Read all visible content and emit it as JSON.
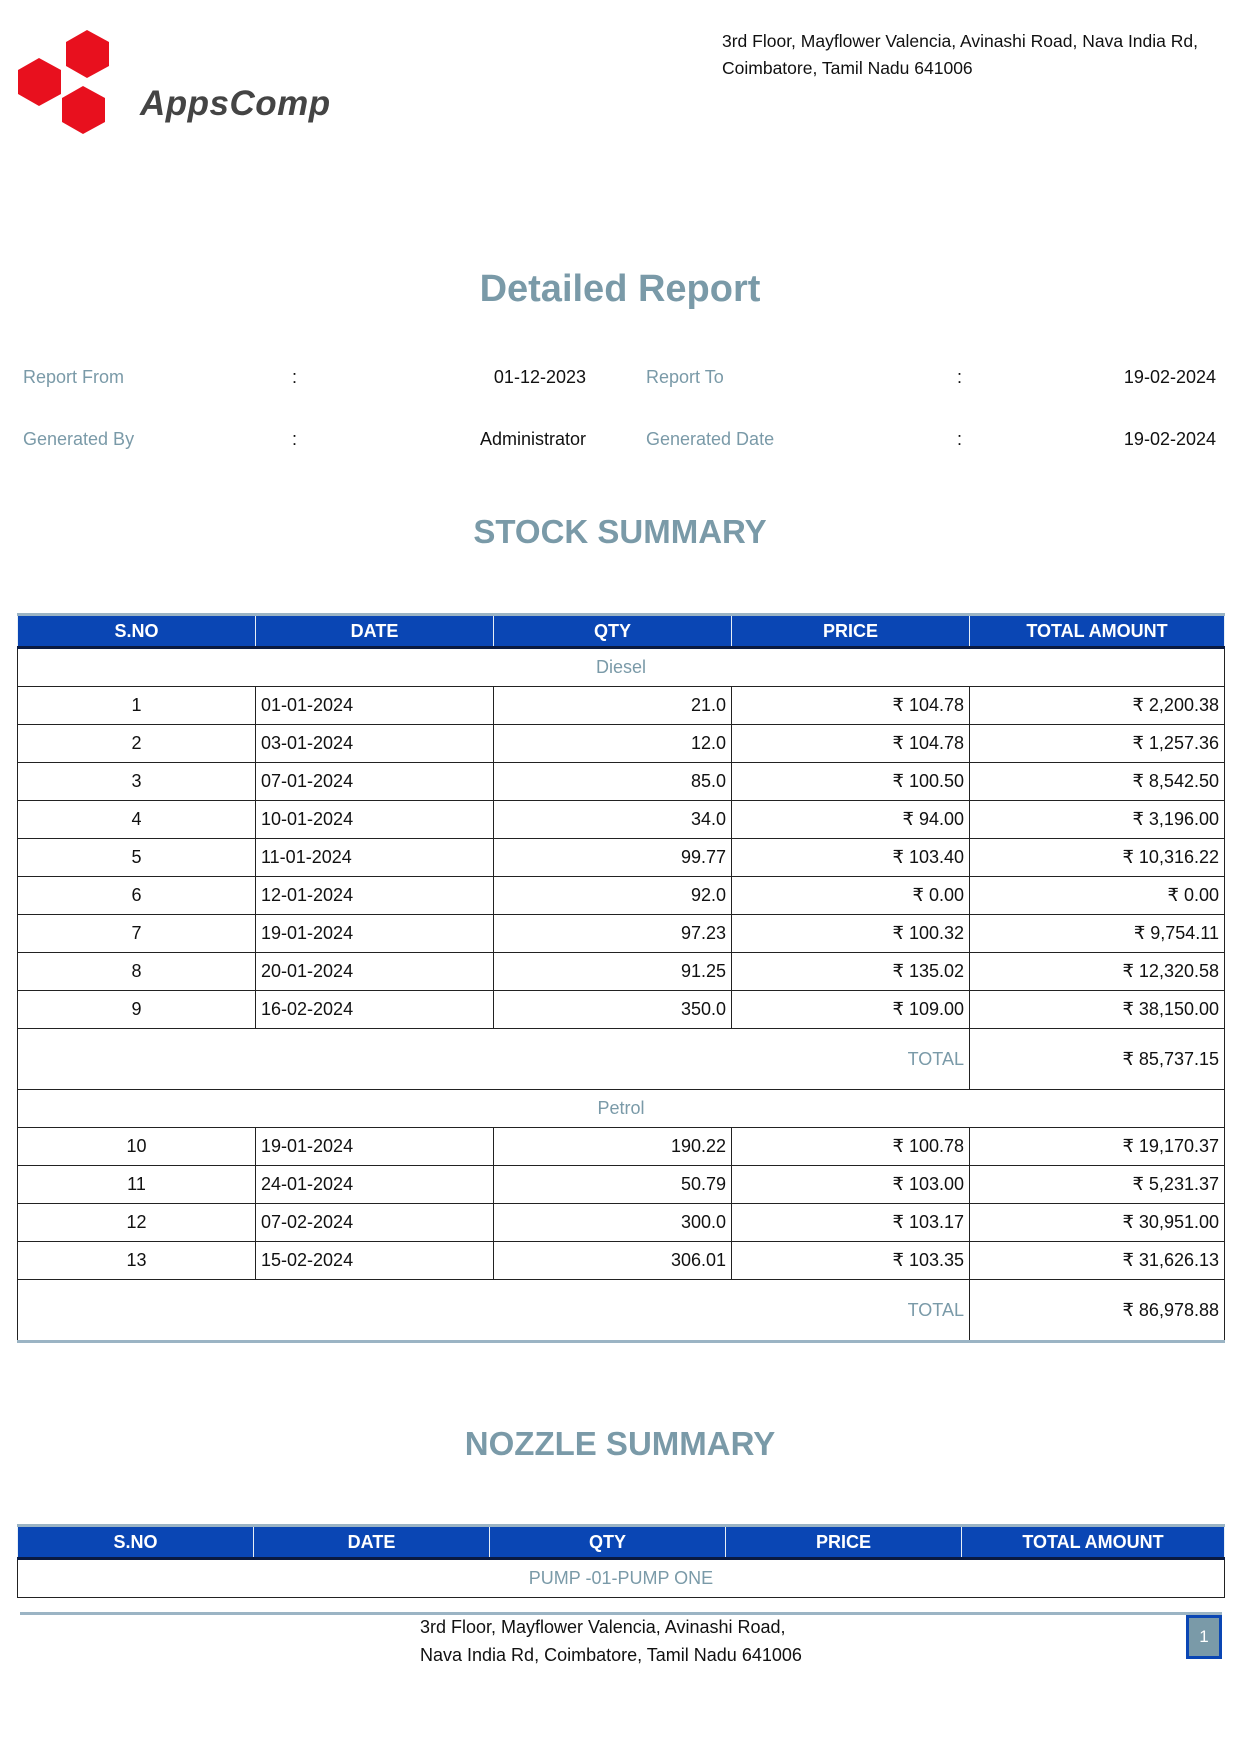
{
  "company": {
    "logo_name": "AppsComp",
    "address_line1": "3rd Floor, Mayflower Valencia, Avinashi Road, Nava India Rd,",
    "address_line2": "Coimbatore, Tamil Nadu 641006"
  },
  "report": {
    "title": "Detailed Report",
    "meta": {
      "from_label": "Report From",
      "from_value": "01-12-2023",
      "to_label": "Report To",
      "to_value": "19-02-2024",
      "generated_by_label": "Generated By",
      "generated_by_value": "Administrator",
      "generated_date_label": "Generated Date",
      "generated_date_value": "19-02-2024",
      "colon": ":"
    }
  },
  "stock_summary": {
    "title": "STOCK SUMMARY",
    "columns": [
      "S.NO",
      "DATE",
      "QTY",
      "PRICE",
      "TOTAL AMOUNT"
    ],
    "groups": [
      {
        "name": "Diesel",
        "rows": [
          [
            "1",
            "01-01-2024",
            "21.0",
            "₹ 104.78",
            "₹ 2,200.38"
          ],
          [
            "2",
            "03-01-2024",
            "12.0",
            "₹ 104.78",
            "₹ 1,257.36"
          ],
          [
            "3",
            "07-01-2024",
            "85.0",
            "₹ 100.50",
            "₹ 8,542.50"
          ],
          [
            "4",
            "10-01-2024",
            "34.0",
            "₹ 94.00",
            "₹ 3,196.00"
          ],
          [
            "5",
            "11-01-2024",
            "99.77",
            "₹ 103.40",
            "₹ 10,316.22"
          ],
          [
            "6",
            "12-01-2024",
            "92.0",
            "₹ 0.00",
            "₹ 0.00"
          ],
          [
            "7",
            "19-01-2024",
            "97.23",
            "₹ 100.32",
            "₹ 9,754.11"
          ],
          [
            "8",
            "20-01-2024",
            "91.25",
            "₹ 135.02",
            "₹ 12,320.58"
          ],
          [
            "9",
            "16-02-2024",
            "350.0",
            "₹ 109.00",
            "₹ 38,150.00"
          ]
        ],
        "total_label": "TOTAL",
        "total_value": "₹ 85,737.15"
      },
      {
        "name": "Petrol",
        "rows": [
          [
            "10",
            "19-01-2024",
            "190.22",
            "₹ 100.78",
            "₹ 19,170.37"
          ],
          [
            "11",
            "24-01-2024",
            "50.79",
            "₹ 103.00",
            "₹ 5,231.37"
          ],
          [
            "12",
            "07-02-2024",
            "300.0",
            "₹ 103.17",
            "₹ 30,951.00"
          ],
          [
            "13",
            "15-02-2024",
            "306.01",
            "₹ 103.35",
            "₹ 31,626.13"
          ]
        ],
        "total_label": "TOTAL",
        "total_value": "₹ 86,978.88"
      }
    ]
  },
  "nozzle_summary": {
    "title": "NOZZLE SUMMARY",
    "columns": [
      "S.NO",
      "DATE",
      "QTY",
      "PRICE",
      "TOTAL AMOUNT"
    ],
    "group": "PUMP -01-PUMP ONE"
  },
  "footer": {
    "address_line1": "3rd Floor, Mayflower Valencia, Avinashi Road,",
    "address_line2": "Nava India Rd, Coimbatore, Tamil Nadu 641006",
    "page_number": "1"
  },
  "colors": {
    "accent": "#7a9aa8",
    "header_blue": "#0a46b4",
    "logo_red": "#e8101e"
  }
}
